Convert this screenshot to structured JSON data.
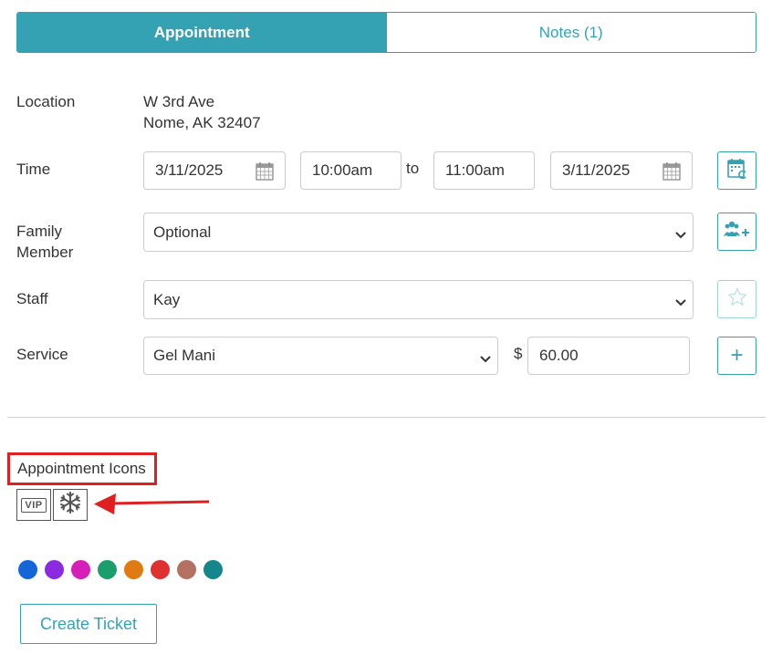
{
  "tabs": {
    "appointment": "Appointment",
    "notes": "Notes (1)"
  },
  "form": {
    "location_label": "Location",
    "address_line1": "W 3rd Ave",
    "address_line2": "Nome, AK 32407",
    "time_label": "Time",
    "start_date": "3/11/2025",
    "start_time": "10:00am",
    "to_label": "to",
    "end_time": "11:00am",
    "end_date": "3/11/2025",
    "family_label_line1": "Family",
    "family_label_line2": "Member",
    "family_value": "Optional",
    "staff_label": "Staff",
    "staff_value": "Kay",
    "service_label": "Service",
    "service_value": "Gel Mani",
    "currency_symbol": "$",
    "price_value": "60.00",
    "add_symbol": "+"
  },
  "icons_section": {
    "title": "Appointment Icons",
    "vip_text": "VIP",
    "icons": [
      "vip-icon",
      "snowflake-icon"
    ]
  },
  "colors": [
    "#1565d8",
    "#8a2be2",
    "#d61fb8",
    "#1a9e6b",
    "#e07a12",
    "#e03131",
    "#b27161",
    "#14868c"
  ],
  "theme": {
    "accent": "#35a2b4",
    "highlight": "#e02020"
  },
  "actions": {
    "create_ticket": "Create Ticket"
  }
}
